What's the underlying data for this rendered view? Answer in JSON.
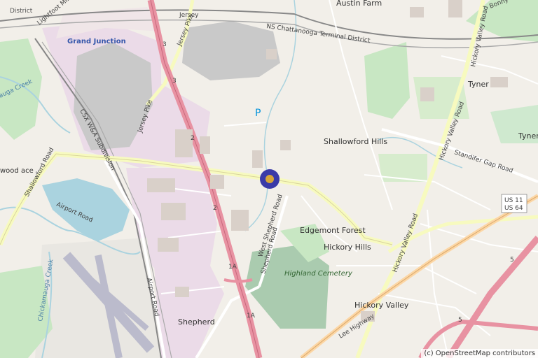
{
  "map": {
    "places": {
      "austin_farm": "Austin Farm",
      "grand_junction": "Grand Junction",
      "tyner_north": "Tyner",
      "tyner_east": "Tyner",
      "shallowford_hills": "Shallowford Hills",
      "edgemont_forest": "Edgemont Forest",
      "hickory_hills": "Hickory Hills",
      "highland_cemetery": "Highland Cemetery",
      "hickory_valley": "Hickory Valley",
      "shepherd": "Shepherd",
      "south_chickamauga": "South Chickamauga Creek",
      "wood_place": "wood ace",
      "district": "District"
    },
    "roads": {
      "jersey": "Jersey",
      "jersey_pike_n": "Jersey Pike",
      "jersey_pike_s": "Jersey Pike",
      "lightfoot": "Lightfoot Mill",
      "ns_railway": "NS Chattanooga Terminal District",
      "csx": "CSX W&A Subdivision",
      "shallowford_rd": "Shallowford Road",
      "airport_rd_w": "Airport Road",
      "airport_rd_s": "Airport Road",
      "west_shepherd": "West Shepherd Road",
      "shepherd_rd": "Shepherd Road",
      "hickory_valley_rd_n": "Hickory Valley Road",
      "hickory_valley_rd_s": "Hickory Valley Road",
      "hickory_valley_rd_mid": "Hickory Valley Road",
      "stanifer_gap": "Standifer Gap Road",
      "bonny_oaks": "Bonny Oaks Drive",
      "lee_highway": "Lee Highway",
      "chickamauga_creek": "Chickamauga Creek",
      "chickamauga_creek_w": "auga Creek"
    },
    "shields": {
      "us": "US 11\nUS 64",
      "us_line1": "US 11",
      "us_line2": "US 64"
    },
    "exits": [
      "3",
      "3",
      "2",
      "2",
      "1A",
      "1A",
      "5",
      "5"
    ],
    "parking": "P",
    "attribution": "(c) OpenStreetMap contributors",
    "marker": "location-pin"
  }
}
